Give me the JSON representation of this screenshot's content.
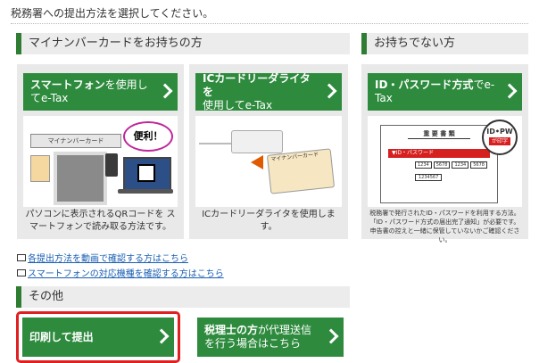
{
  "instruction": "税務署への提出方法を選択してください。",
  "section_mynumber": {
    "title": "マイナンバーカードをお持ちの方",
    "smartphone": {
      "button_bold": "スマートフォン",
      "button_rest": "を使用してe-Tax",
      "illus_card_label": "マイナンバーカード",
      "illus_bubble": "便利！",
      "caption": "パソコンに表示されるQRコードを スマートフォンで読み取る方法です。"
    },
    "icreader": {
      "button_line1": "ICカードリーダライタを",
      "button_line2": "使用してe-Tax",
      "illus_card_label": "マイナンバーカード",
      "caption": "ICカードリーダライタを使用します。"
    }
  },
  "section_nocard": {
    "title": "お持ちでない方",
    "idpw": {
      "button_bold": "ID・パスワード方式",
      "button_rest": "でe-Tax",
      "illus_doc_title": "重 要 書 類",
      "illus_badge_line1": "ID•PW",
      "illus_badge_line2": "が印字",
      "illus_band": "▼ID・パスワード",
      "illus_fields": [
        "1234",
        "5678",
        "1234",
        "5678"
      ],
      "illus_id": "1234567",
      "caption_line1": "税務署で発行されたID・パスワードを利用する方法。",
      "caption_line2": "「ID・パスワード方式の届出完了通知」が必要です。",
      "caption_line3": "申告書の控えと一緒に保管していないかご確認ください。"
    }
  },
  "links": [
    "各提出方法を動画で確認する方はこちら",
    "スマートフォンの対応機種を確認する方はこちら"
  ],
  "section_other": {
    "title": "その他",
    "print_button": "印刷して提出",
    "proxy_button_bold": "税理士の方",
    "proxy_button_rest": "が代理送信",
    "proxy_button_line2": "を行う場合はこちら"
  },
  "colors": {
    "button_green": "#2e8b3e",
    "accent_green": "#2e7d32",
    "highlight_red": "#e02020",
    "link_blue": "#1a5fb4"
  }
}
